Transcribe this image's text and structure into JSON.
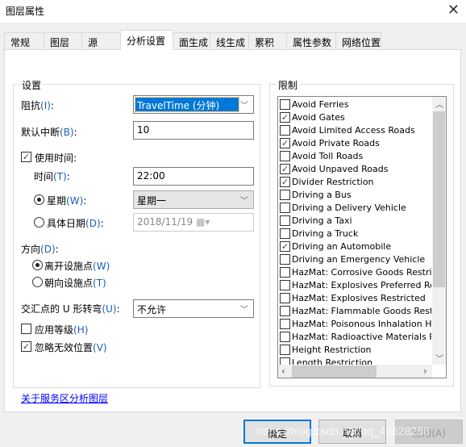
{
  "window": {
    "title": "图层属性",
    "close_icon": "close-icon"
  },
  "tabs": [
    "常规",
    "图层",
    "源",
    "分析设置",
    "面生成",
    "线生成",
    "累积",
    "属性参数",
    "网络位置"
  ],
  "active_tab": "分析设置",
  "settings": {
    "group_label": "设置",
    "impedance": {
      "label": "阻抗",
      "key": "(I)",
      "colon": ":",
      "value": "TravelTime (分钟)"
    },
    "default_cutoff": {
      "label": "默认中断",
      "key": "(B)",
      "colon": ":",
      "value": "10"
    },
    "use_time": {
      "label": "使用时间:",
      "checked": true
    },
    "time": {
      "label": "时间",
      "key": "(T)",
      "colon": ":",
      "value": "22:00"
    },
    "weekday": {
      "label": "星期",
      "key": "(W)",
      "colon": ":",
      "value": "星期一",
      "selected": true
    },
    "specific_date": {
      "label": "具体日期",
      "key": "(D)",
      "colon": ":",
      "value": "2018/11/19",
      "selected": false
    },
    "direction": {
      "label": "方向",
      "key": "(D)",
      "colon": ":"
    },
    "away": {
      "label": "离开设施点",
      "key": "(W)",
      "selected": true
    },
    "toward": {
      "label": "朝向设施点",
      "key": "(T)",
      "selected": false
    },
    "uturn": {
      "label": "交汇点的 U 形转弯",
      "key": "(U)",
      "colon": ":",
      "value": "不允许"
    },
    "hierarchy": {
      "label": "应用等级",
      "key": "(H)",
      "checked": false
    },
    "ignore_invalid": {
      "label": "忽略无效位置",
      "key": "(V)",
      "checked": true
    }
  },
  "link": "关于服务区分析图层",
  "restrictions": {
    "group_label": "限制",
    "items": [
      {
        "label": "Avoid Ferries",
        "checked": false
      },
      {
        "label": "Avoid Gates",
        "checked": true
      },
      {
        "label": "Avoid Limited Access Roads",
        "checked": false
      },
      {
        "label": "Avoid Private Roads",
        "checked": true
      },
      {
        "label": "Avoid Toll Roads",
        "checked": false
      },
      {
        "label": "Avoid Unpaved Roads",
        "checked": true
      },
      {
        "label": "Divider Restriction",
        "checked": true
      },
      {
        "label": "Driving a Bus",
        "checked": false
      },
      {
        "label": "Driving a Delivery Vehicle",
        "checked": false
      },
      {
        "label": "Driving a Taxi",
        "checked": false
      },
      {
        "label": "Driving a Truck",
        "checked": false
      },
      {
        "label": "Driving an Automobile",
        "checked": true
      },
      {
        "label": "Driving an Emergency Vehicle",
        "checked": false
      },
      {
        "label": "HazMat: Corrosive Goods Restricted",
        "checked": false
      },
      {
        "label": "HazMat: Explosives Preferred Route",
        "checked": false
      },
      {
        "label": "HazMat: Explosives Restricted",
        "checked": false
      },
      {
        "label": "HazMat: Flammable Goods Restricted",
        "checked": false
      },
      {
        "label": "HazMat: Poisonous Inhalation Hazard",
        "checked": false
      },
      {
        "label": "HazMat: Radioactive Materials Preferred",
        "checked": false
      },
      {
        "label": "Height Restriction",
        "checked": false
      },
      {
        "label": "Length Restriction",
        "checked": false
      }
    ]
  },
  "buttons": {
    "ok": "确定",
    "cancel": "取消",
    "apply": "应用(A)"
  },
  "watermark": "https://blog.csdn.net/qq_40628258",
  "colors": {
    "accent": "#0078d7",
    "selection": "#0078d7",
    "link": "#0000ff"
  }
}
